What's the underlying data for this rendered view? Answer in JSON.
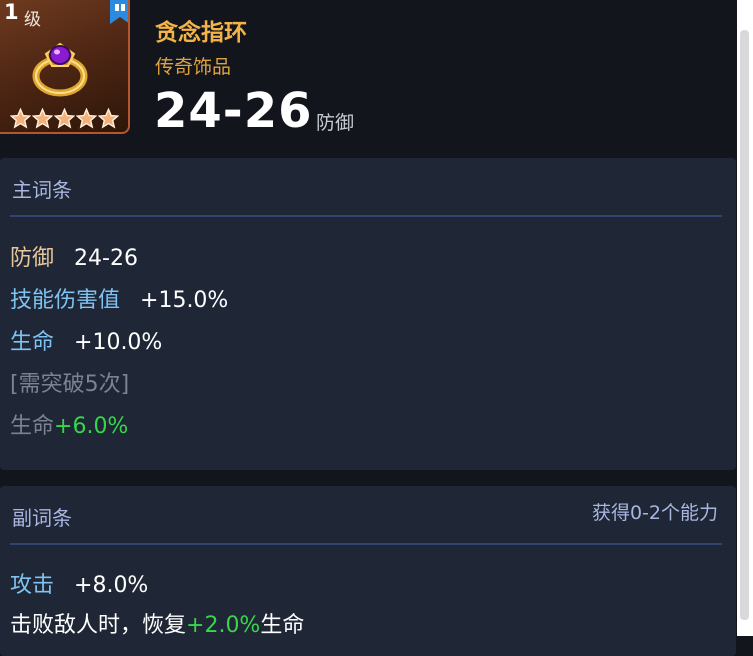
{
  "item": {
    "level": "1",
    "level_unit": "级",
    "stars": 5,
    "name": "贪念指环",
    "rarity": "传奇饰品",
    "value": "24-26",
    "value_stat": "防御"
  },
  "main_affixes": {
    "title": "主词条",
    "rows": [
      {
        "name": "防御",
        "value": "24-26"
      },
      {
        "name": "技能伤害值",
        "value": "+15.0%"
      },
      {
        "name": "生命",
        "value": "+10.0%"
      }
    ],
    "locked_label": "[需突破5次]",
    "locked_stat": "生命",
    "locked_value": "+6.0%"
  },
  "sub_affixes": {
    "title": "副词条",
    "note": "获得0-2个能力",
    "rows": [
      {
        "name": "攻击",
        "value": "+8.0%"
      }
    ],
    "partial_prefix": "击败敌人时，恢复",
    "partial_value": "+2.0%",
    "partial_suffix": "生命"
  },
  "colors": {
    "rarity_gold": "#f2b347",
    "stat_blue": "#7fc3f2",
    "stat_gold": "#e8c79c",
    "bonus_green": "#37d64a",
    "panel_bg": "#1f2636"
  },
  "icons": [
    "bookmark-icon",
    "ring-icon",
    "star-icon"
  ]
}
